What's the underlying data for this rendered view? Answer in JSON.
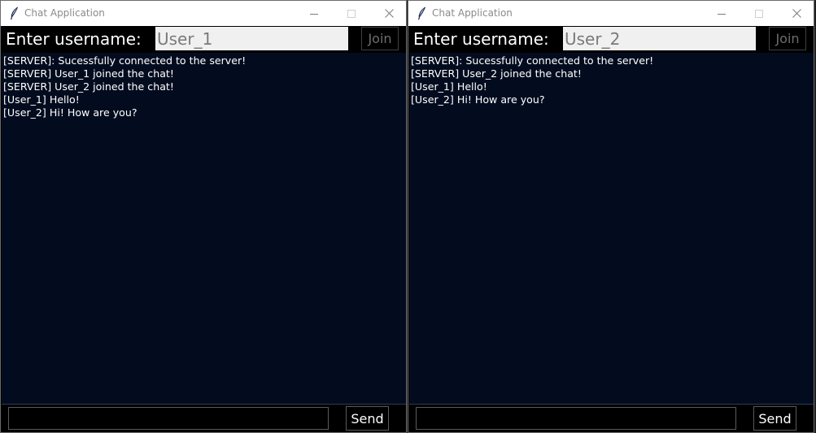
{
  "theme": {
    "chat_background": "#030c1f",
    "window_background": "#000000",
    "titlebar_background": "#ffffff",
    "input_background": "#f0f0f0"
  },
  "windows": [
    {
      "title": "Chat Application",
      "username_label": "Enter username:",
      "username_value": "User_1",
      "join_label": "Join",
      "send_label": "Send",
      "message_value": "",
      "messages": [
        "[SERVER]: Sucessfully connected to the server!",
        "[SERVER] User_1 joined the chat!",
        "[SERVER] User_2 joined the chat!",
        "[User_1] Hello!",
        "[User_2] Hi! How are you?"
      ]
    },
    {
      "title": "Chat Application",
      "username_label": "Enter username:",
      "username_value": "User_2",
      "join_label": "Join",
      "send_label": "Send",
      "message_value": "",
      "messages": [
        "[SERVER]: Sucessfully connected to the server!",
        "[SERVER] User_2 joined the chat!",
        "[User_1] Hello!",
        "[User_2] Hi! How are you?"
      ]
    }
  ],
  "icons": {
    "app": "feather-icon",
    "minimize": "minimize-icon",
    "maximize": "maximize-icon",
    "close": "close-icon"
  }
}
